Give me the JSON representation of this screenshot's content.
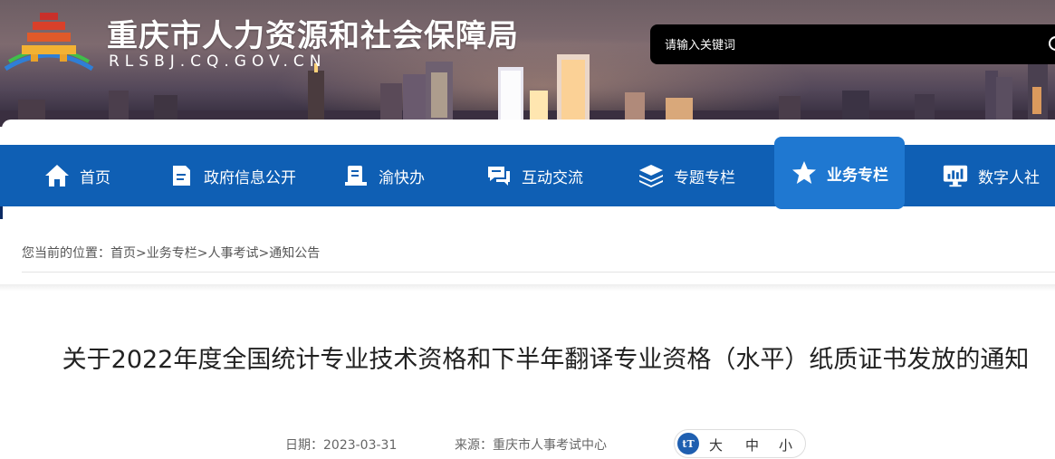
{
  "header": {
    "site_title": "重庆市人力资源和社会保障局",
    "site_domain": "RLSBJ.CQ.GOV.CN",
    "search_placeholder": "请输入关键词"
  },
  "nav": {
    "items": [
      {
        "label": "首页",
        "icon": "home-icon"
      },
      {
        "label": "政府信息公开",
        "icon": "document-icon"
      },
      {
        "label": "渝快办",
        "icon": "book-icon"
      },
      {
        "label": "互动交流",
        "icon": "chat-icon"
      },
      {
        "label": "专题专栏",
        "icon": "layers-icon"
      },
      {
        "label": "业务专栏",
        "icon": "star-icon",
        "active": true
      },
      {
        "label": "数字人社",
        "icon": "monitor-icon"
      }
    ]
  },
  "breadcrumb": {
    "prefix": "您当前的位置：",
    "items": [
      "首页",
      "业务专栏",
      "人事考试",
      "通知公告"
    ],
    "separator": ">"
  },
  "article": {
    "title": "关于2022年度全国统计专业技术资格和下半年翻译专业资格（水平）纸质证书发放的通知",
    "date_label": "日期：",
    "date": "2023-03-31",
    "source_label": "来源：",
    "source": "重庆市人事考试中心"
  },
  "font_size": {
    "icon_text": "tT",
    "large": "大",
    "medium": "中",
    "small": "小"
  },
  "colors": {
    "nav_bg": "#0f5fb4",
    "nav_active": "#1f78d1",
    "search_bg": "#000000"
  }
}
